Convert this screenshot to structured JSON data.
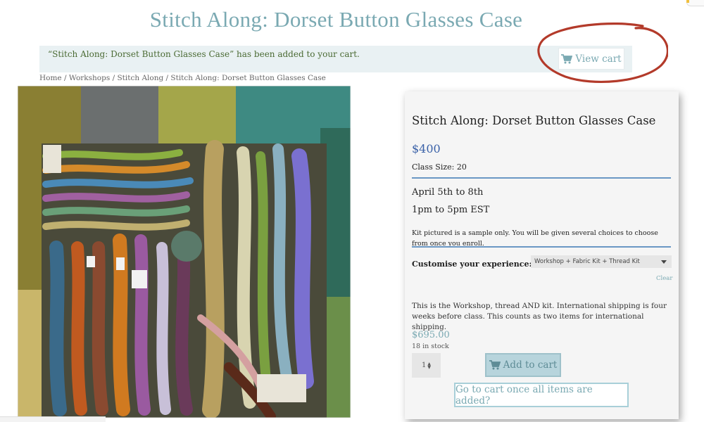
{
  "page": {
    "title": "Stitch Along: Dorset Button Glasses Case"
  },
  "notice": {
    "message": "“Stitch Along: Dorset Button Glasses Case” has been added to your cart.",
    "view_cart_label": "View cart",
    "icon": "cart-icon"
  },
  "breadcrumb": {
    "items": [
      "Home",
      "Workshops",
      "Stitch Along",
      "Stitch Along: Dorset Button Glasses Case"
    ],
    "separator": " / "
  },
  "product": {
    "title": "Stitch Along: Dorset Button Glasses Case",
    "price": "$400",
    "class_size": "Class Size: 20",
    "dates": "April 5th to 8th",
    "times": "1pm to 5pm EST",
    "kit_note": "Kit pictured is a sample only.  You will be given several choices to choose from once you enroll.",
    "customise_label": "Customise your experience:",
    "selected_option": "Workshop + Fabric Kit + Thread Kit",
    "clear_label": "Clear",
    "variation_description": "This is the Workshop, thread AND kit. International shipping is four weeks before class. This counts as two items for international shipping.",
    "variation_price": "$695.00",
    "stock": "18 in stock",
    "quantity": "1",
    "add_to_cart_label": "Add to cart",
    "go_to_cart_label": "Go to cart once all items are added?"
  },
  "colors": {
    "title": "#7aa9b2",
    "price": "#3b62a8",
    "notice_bg": "#e9f1f3",
    "annotation": "#b33a2a"
  }
}
